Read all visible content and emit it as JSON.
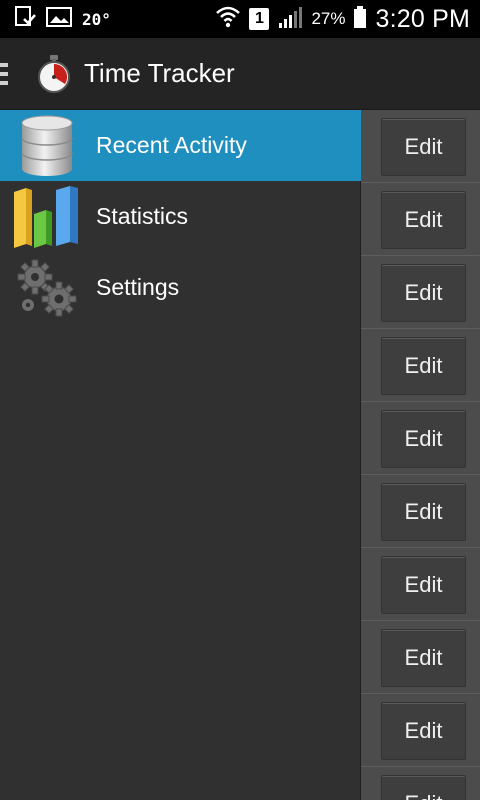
{
  "status_bar": {
    "temperature": "20°",
    "sim_slot": "1",
    "battery_percent": "27%",
    "time": "3:20 PM"
  },
  "action_bar": {
    "title": "Time Tracker",
    "icon": "stopwatch-icon"
  },
  "drawer": {
    "items": [
      {
        "label": "Recent Activity",
        "icon": "database-icon",
        "selected": true
      },
      {
        "label": "Statistics",
        "icon": "bar-chart-icon",
        "selected": false
      },
      {
        "label": "Settings",
        "icon": "gears-icon",
        "selected": false
      }
    ]
  },
  "list": {
    "rows": [
      {
        "button_label": "Edit"
      },
      {
        "button_label": "Edit"
      },
      {
        "button_label": "Edit"
      },
      {
        "button_label": "Edit"
      },
      {
        "button_label": "Edit"
      },
      {
        "button_label": "Edit"
      },
      {
        "button_label": "Edit"
      },
      {
        "button_label": "Edit"
      },
      {
        "button_label": "Edit"
      },
      {
        "button_label": "Edit"
      }
    ]
  },
  "colors": {
    "accent": "#1f8fbf",
    "drawer_bg": "#303030",
    "actionbar_bg": "#242424"
  }
}
